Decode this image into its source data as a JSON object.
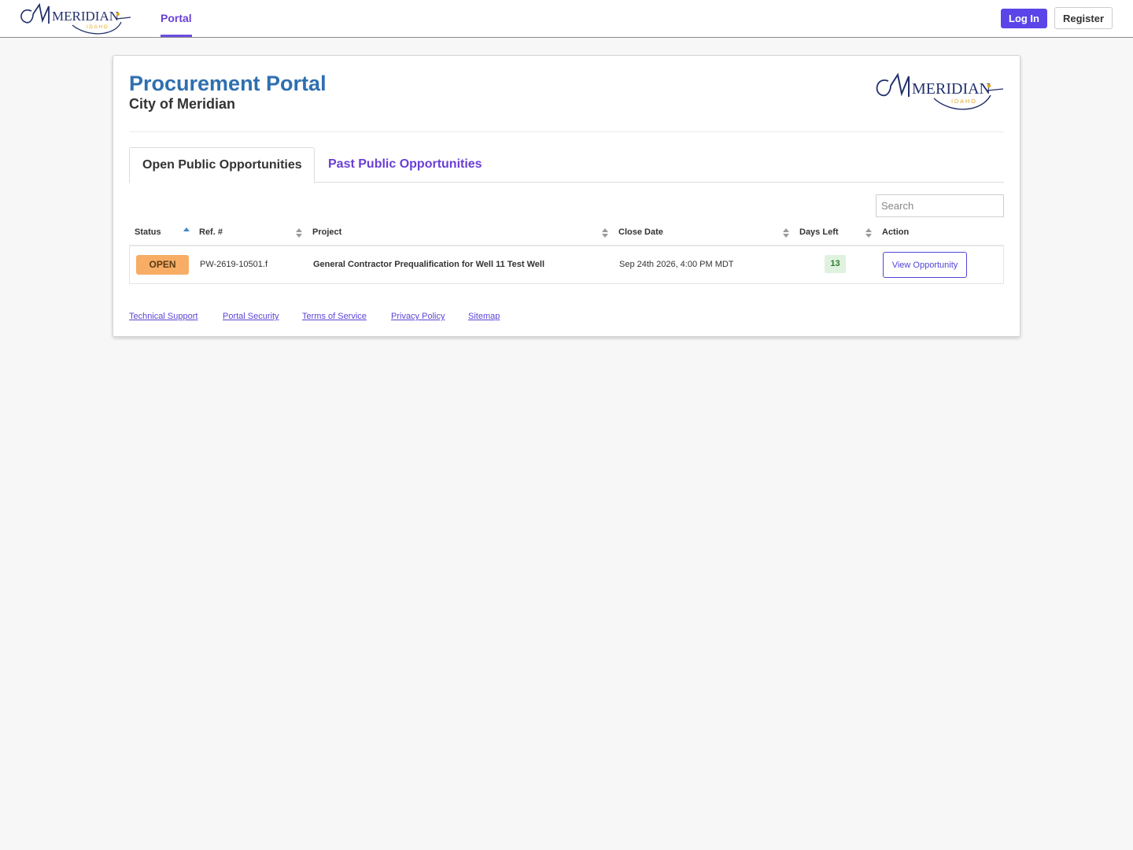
{
  "nav": {
    "logo_text": "MERIDIAN",
    "logo_sub": "IDAHO",
    "portal_label": "Portal",
    "login_label": "Log In",
    "register_label": "Register"
  },
  "header": {
    "title": "Procurement Portal",
    "subtitle": "City of Meridian",
    "logo_text": "MERIDIAN",
    "logo_sub": "IDAHO"
  },
  "tabs": [
    {
      "label": "Open Public Opportunities",
      "active": true
    },
    {
      "label": "Past Public Opportunities",
      "active": false
    }
  ],
  "search": {
    "placeholder": "Search",
    "value": ""
  },
  "table": {
    "columns": [
      "Status",
      "Ref. #",
      "Project",
      "Close Date",
      "Days Left",
      "Action"
    ],
    "sorted_column": "Status",
    "rows": [
      {
        "status": "OPEN",
        "ref": "PW-2619-10501.f",
        "project": "General Contractor Prequalification for Well 11 Test Well",
        "close_date": "Sep 24th 2026, 4:00 PM MDT",
        "days_left": "13",
        "action": "View Opportunity"
      }
    ]
  },
  "footer": {
    "links": [
      "Technical Support",
      "Portal Security",
      "Terms of Service",
      "Privacy Policy",
      "Sitemap"
    ]
  },
  "colors": {
    "accent": "#5b45e8",
    "title_blue": "#2f6fb0",
    "logo_navy": "#22306b",
    "logo_gold": "#e5a823",
    "status_open": "#f7ad66",
    "days_left_bg": "#dff2df"
  }
}
